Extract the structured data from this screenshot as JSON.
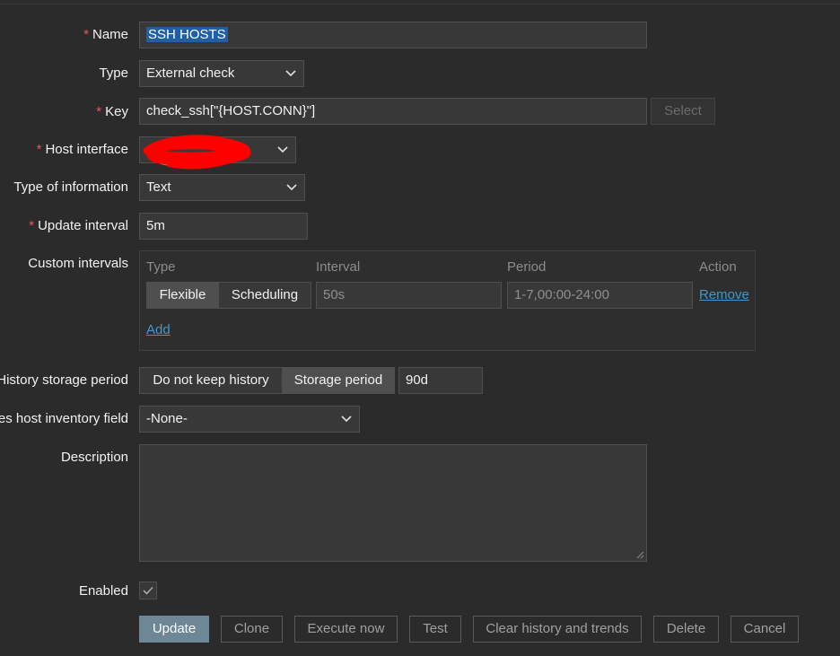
{
  "form": {
    "name": {
      "label": "Name",
      "value": "SSH HOSTS"
    },
    "type": {
      "label": "Type",
      "value": "External check"
    },
    "key": {
      "label": "Key",
      "value": "check_ssh[\"{HOST.CONN}\"]",
      "select_label": "Select"
    },
    "host_interface": {
      "label": "Host interface",
      "value": ""
    },
    "type_of_information": {
      "label": "Type of information",
      "value": "Text"
    },
    "update_interval": {
      "label": "Update interval",
      "value": "5m"
    },
    "custom_intervals": {
      "label": "Custom intervals",
      "headers": {
        "type": "Type",
        "interval": "Interval",
        "period": "Period",
        "action": "Action"
      },
      "rows": [
        {
          "type_options": [
            "Flexible",
            "Scheduling"
          ],
          "type_selected": "Flexible",
          "interval": "50s",
          "period": "1-7,00:00-24:00",
          "action": "Remove"
        }
      ],
      "add_label": "Add"
    },
    "history": {
      "label": "History storage period",
      "options": [
        "Do not keep history",
        "Storage period"
      ],
      "selected": "Storage period",
      "value": "90d"
    },
    "inventory": {
      "label": "es host inventory field",
      "value": "-None-"
    },
    "description": {
      "label": "Description",
      "value": ""
    },
    "enabled": {
      "label": "Enabled",
      "checked": true
    }
  },
  "buttons": {
    "update": "Update",
    "clone": "Clone",
    "execute_now": "Execute now",
    "test": "Test",
    "clear_history": "Clear history and trends",
    "delete": "Delete",
    "cancel": "Cancel"
  },
  "colors": {
    "background": "#2b2b2b",
    "field": "#383838",
    "required": "#e45959",
    "link": "#4796c4",
    "primary_button": "#6d8796",
    "selection": "#1f5fa8"
  }
}
